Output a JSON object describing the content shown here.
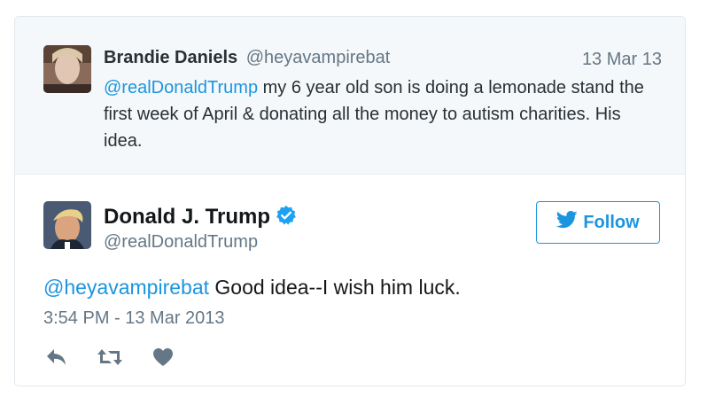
{
  "parent_tweet": {
    "author_name": "Brandie Daniels",
    "author_handle": "@heyavampirebat",
    "date": "13 Mar 13",
    "mention": "@realDonaldTrump",
    "text": " my 6 year old son is doing a lemonade stand the first week of April & donating all the money to autism charities. His idea."
  },
  "main_tweet": {
    "author_name": "Donald J. Trump",
    "author_handle": "@realDonaldTrump",
    "verified": true,
    "follow_label": "Follow",
    "mention": "@heyavampirebat",
    "text": " Good idea--I wish him luck.",
    "timestamp": "3:54 PM - 13 Mar 2013"
  },
  "actions": {
    "icons": [
      "reply-icon",
      "retweet-icon",
      "like-icon"
    ]
  },
  "colors": {
    "accent": "#1b95e0",
    "secondary_text": "#657786",
    "primary_text": "#14171a",
    "icon": "#657786",
    "parent_bg": "#f5f8fa"
  }
}
